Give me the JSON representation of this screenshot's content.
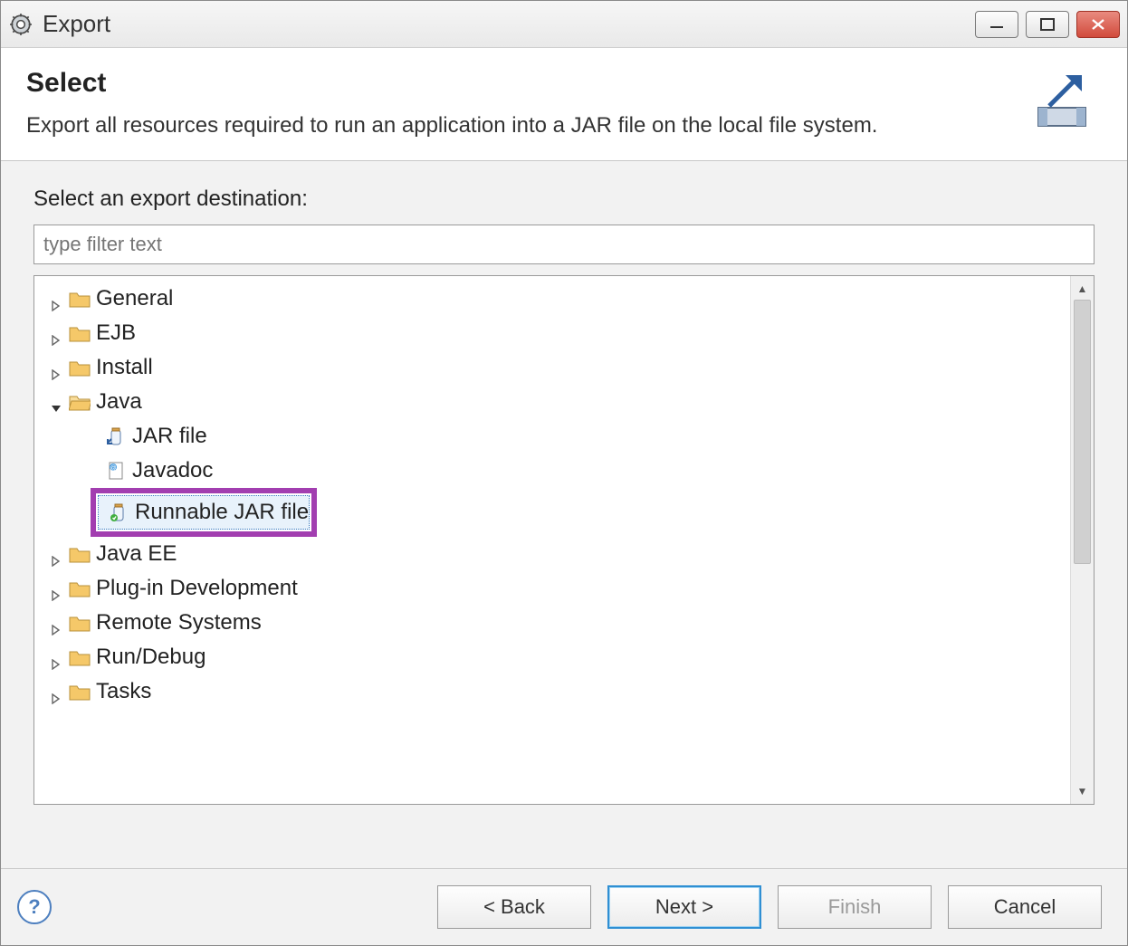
{
  "window": {
    "title": "Export"
  },
  "header": {
    "title": "Select",
    "description": "Export all resources required to run an application into a JAR file on the local file system."
  },
  "body": {
    "label": "Select an export destination:",
    "filter_placeholder": "type filter text"
  },
  "tree": {
    "items": [
      {
        "label": "General",
        "expanded": false,
        "type": "folder"
      },
      {
        "label": "EJB",
        "expanded": false,
        "type": "folder"
      },
      {
        "label": "Install",
        "expanded": false,
        "type": "folder"
      },
      {
        "label": "Java",
        "expanded": true,
        "type": "folder",
        "children": [
          {
            "label": "JAR file",
            "type": "jar"
          },
          {
            "label": "Javadoc",
            "type": "javadoc"
          },
          {
            "label": "Runnable JAR file",
            "type": "jar",
            "selected": true,
            "highlighted": true
          }
        ]
      },
      {
        "label": "Java EE",
        "expanded": false,
        "type": "folder"
      },
      {
        "label": "Plug-in Development",
        "expanded": false,
        "type": "folder"
      },
      {
        "label": "Remote Systems",
        "expanded": false,
        "type": "folder"
      },
      {
        "label": "Run/Debug",
        "expanded": false,
        "type": "folder"
      },
      {
        "label": "Tasks",
        "expanded": false,
        "type": "folder"
      }
    ]
  },
  "footer": {
    "back_label": "< Back",
    "next_label": "Next >",
    "finish_label": "Finish",
    "cancel_label": "Cancel"
  }
}
